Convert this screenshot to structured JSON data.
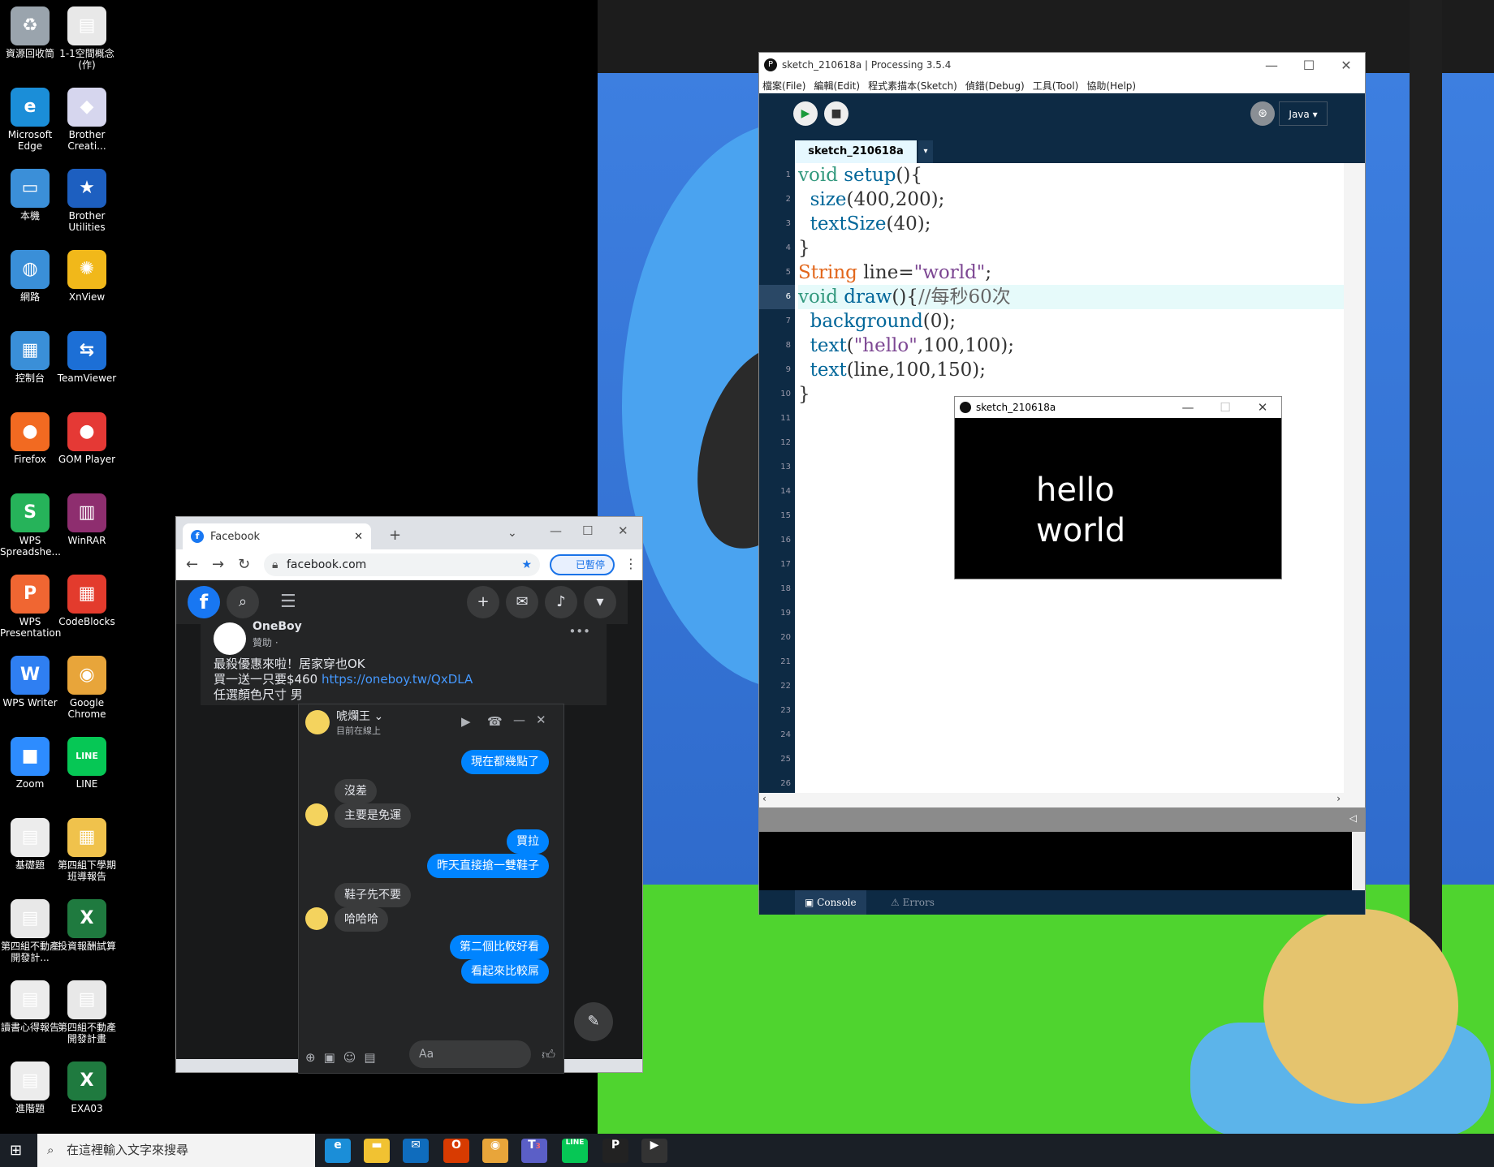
{
  "desktop_icons": [
    {
      "label": "資源回收筒",
      "color": "#9aa4ad",
      "glyph": "♻"
    },
    {
      "label": "1-1空間概念(作)",
      "color": "#e8e8e8",
      "glyph": "▤"
    },
    {
      "label": "Microsoft Edge",
      "color": "#1b8ed8",
      "glyph": "e"
    },
    {
      "label": "Brother Creati...",
      "color": "#d6d6ee",
      "glyph": "◆"
    },
    {
      "label": "本機",
      "color": "#3b8fd8",
      "glyph": "▭"
    },
    {
      "label": "Brother Utilities",
      "color": "#1d5fc0",
      "glyph": "★"
    },
    {
      "label": "網路",
      "color": "#3a8fd8",
      "glyph": "◍"
    },
    {
      "label": "XnView",
      "color": "#f1b81a",
      "glyph": "✺"
    },
    {
      "label": "控制台",
      "color": "#3a8fd8",
      "glyph": "▦"
    },
    {
      "label": "TeamViewer",
      "color": "#1c6fd6",
      "glyph": "⇆"
    },
    {
      "label": "Firefox",
      "color": "#f26a21",
      "glyph": "●"
    },
    {
      "label": "GOM Player",
      "color": "#e53935",
      "glyph": "●"
    },
    {
      "label": "WPS Spreadshe...",
      "color": "#26b35a",
      "glyph": "S"
    },
    {
      "label": "WinRAR",
      "color": "#8e2e6f",
      "glyph": "▥"
    },
    {
      "label": "WPS Presentation",
      "color": "#f06632",
      "glyph": "P"
    },
    {
      "label": "CodeBlocks",
      "color": "#e33b2d",
      "glyph": "▦"
    },
    {
      "label": "WPS Writer",
      "color": "#2f7ff2",
      "glyph": "W"
    },
    {
      "label": "Google Chrome",
      "color": "#e8a53a",
      "glyph": "◉"
    },
    {
      "label": "Zoom",
      "color": "#2d8cff",
      "glyph": "■"
    },
    {
      "label": "LINE",
      "color": "#06c755",
      "glyph": "LINE"
    },
    {
      "label": "基礎題",
      "color": "#ececec",
      "glyph": "▤"
    },
    {
      "label": "第四組下學期班導報告",
      "color": "#f0c24c",
      "glyph": "▦"
    },
    {
      "label": "第四組不動產開發計...",
      "color": "#e8e8e8",
      "glyph": "▤"
    },
    {
      "label": "投資報酬試算",
      "color": "#1f7a3f",
      "glyph": "X"
    },
    {
      "label": "讀書心得報告",
      "color": "#ececec",
      "glyph": "▤"
    },
    {
      "label": "第四組不動產開發計畫",
      "color": "#e8e8e8",
      "glyph": "▤"
    },
    {
      "label": "進階題",
      "color": "#ececec",
      "glyph": "▤"
    },
    {
      "label": "EXA03",
      "color": "#1f7a3f",
      "glyph": "X"
    }
  ],
  "processing": {
    "title": "sketch_210618a | Processing 3.5.4",
    "menu": [
      "檔案(File)",
      "編輯(Edit)",
      "程式素描本(Sketch)",
      "偵錯(Debug)",
      "工具(Tool)",
      "協助(Help)"
    ],
    "mode": "Java ▾",
    "tab": "sketch_210618a",
    "lines": [
      "void setup(){",
      "  size(400,200);",
      "  textSize(40);",
      "}",
      "String line=\"world\";",
      "void draw(){//每秒60次",
      "  background(0);",
      "  text(\"hello\",100,100);",
      "  text(line,100,150);",
      "}"
    ],
    "line_numbers": [
      "1",
      "2",
      "3",
      "4",
      "5",
      "6",
      "7",
      "8",
      "9",
      "10",
      "11",
      "12",
      "13",
      "14",
      "15",
      "16",
      "17",
      "18",
      "19",
      "20",
      "21",
      "22",
      "23",
      "24",
      "25",
      "26"
    ],
    "console_tab": "Console",
    "errors_tab": "Errors"
  },
  "sketch_window": {
    "title": "sketch_210618a",
    "line1": "hello",
    "line2": "world"
  },
  "chrome": {
    "tab_title": "Facebook",
    "url": "facebook.com",
    "paused": "已暫停",
    "post_author": "OneBoy",
    "post_meta": "贊助 · ",
    "post_line1": "最殺優惠來啦！居家穿也OK",
    "post_line2": "買一送一只要$460 ",
    "post_link": "https://oneboy.tw/QxDLA",
    "post_line3": "任選顏色尺寸 男"
  },
  "messenger": {
    "name": "唬爛王 ⌄",
    "status": "目前在線上",
    "input_placeholder": "Aa",
    "messages": [
      {
        "text": "現在都幾點了",
        "me": true
      },
      {
        "text": "沒差",
        "me": false
      },
      {
        "text": "主要是免運",
        "me": false
      },
      {
        "text": "買拉",
        "me": true
      },
      {
        "text": "昨天直接搶一雙鞋子",
        "me": true
      },
      {
        "text": "鞋子先不要",
        "me": false
      },
      {
        "text": "哈哈哈",
        "me": false
      },
      {
        "text": "第二個比較好看",
        "me": true
      },
      {
        "text": "看起來比較屌",
        "me": true
      }
    ]
  },
  "taskbar": {
    "search_placeholder": "在這裡輸入文字來搜尋",
    "teams_badge": "3"
  }
}
